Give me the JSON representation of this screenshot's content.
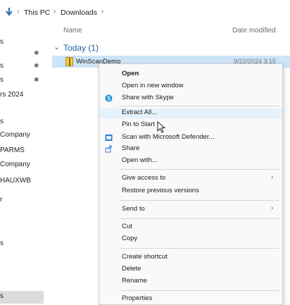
{
  "breadcrumb": {
    "items": [
      "This PC",
      "Downloads"
    ]
  },
  "columns": {
    "name": "Name",
    "date_modified": "Date modified"
  },
  "sidebar": {
    "items": [
      {
        "label": "s"
      },
      {
        "label": "s"
      },
      {
        "label": "s"
      },
      {
        "label": "rs 2024"
      },
      {
        "label": "s"
      },
      {
        "label": "Company"
      },
      {
        "label": "PARMS"
      },
      {
        "label": "Company"
      },
      {
        "label": "HAUXWB"
      },
      {
        "label": "r"
      },
      {
        "label": "s"
      },
      {
        "label": "s"
      }
    ]
  },
  "group": {
    "label": "Today (1)"
  },
  "file": {
    "name": "WinScanDemo",
    "date": "9/22/2024 3:15"
  },
  "context_menu": {
    "items": [
      {
        "label": "Open",
        "icon": ""
      },
      {
        "label": "Open in new window",
        "icon": ""
      },
      {
        "label": "Share with Skype",
        "icon": "skype-icon"
      },
      {
        "label": "Extract All...",
        "icon": ""
      },
      {
        "label": "Pin to Start",
        "icon": ""
      },
      {
        "label": "Scan with Microsoft Defender...",
        "icon": "defender-icon"
      },
      {
        "label": "Share",
        "icon": "share-icon"
      },
      {
        "label": "Open with...",
        "icon": ""
      },
      {
        "label": "Give access to",
        "icon": "",
        "submenu": true
      },
      {
        "label": "Restore previous versions",
        "icon": ""
      },
      {
        "label": "Send to",
        "icon": "",
        "submenu": true
      },
      {
        "label": "Cut",
        "icon": ""
      },
      {
        "label": "Copy",
        "icon": ""
      },
      {
        "label": "Create shortcut",
        "icon": ""
      },
      {
        "label": "Delete",
        "icon": ""
      },
      {
        "label": "Rename",
        "icon": ""
      },
      {
        "label": "Properties",
        "icon": ""
      }
    ]
  },
  "colors": {
    "selection": "#cce4f7",
    "hover": "#e5f1fb",
    "accent": "#1f5fa8"
  }
}
